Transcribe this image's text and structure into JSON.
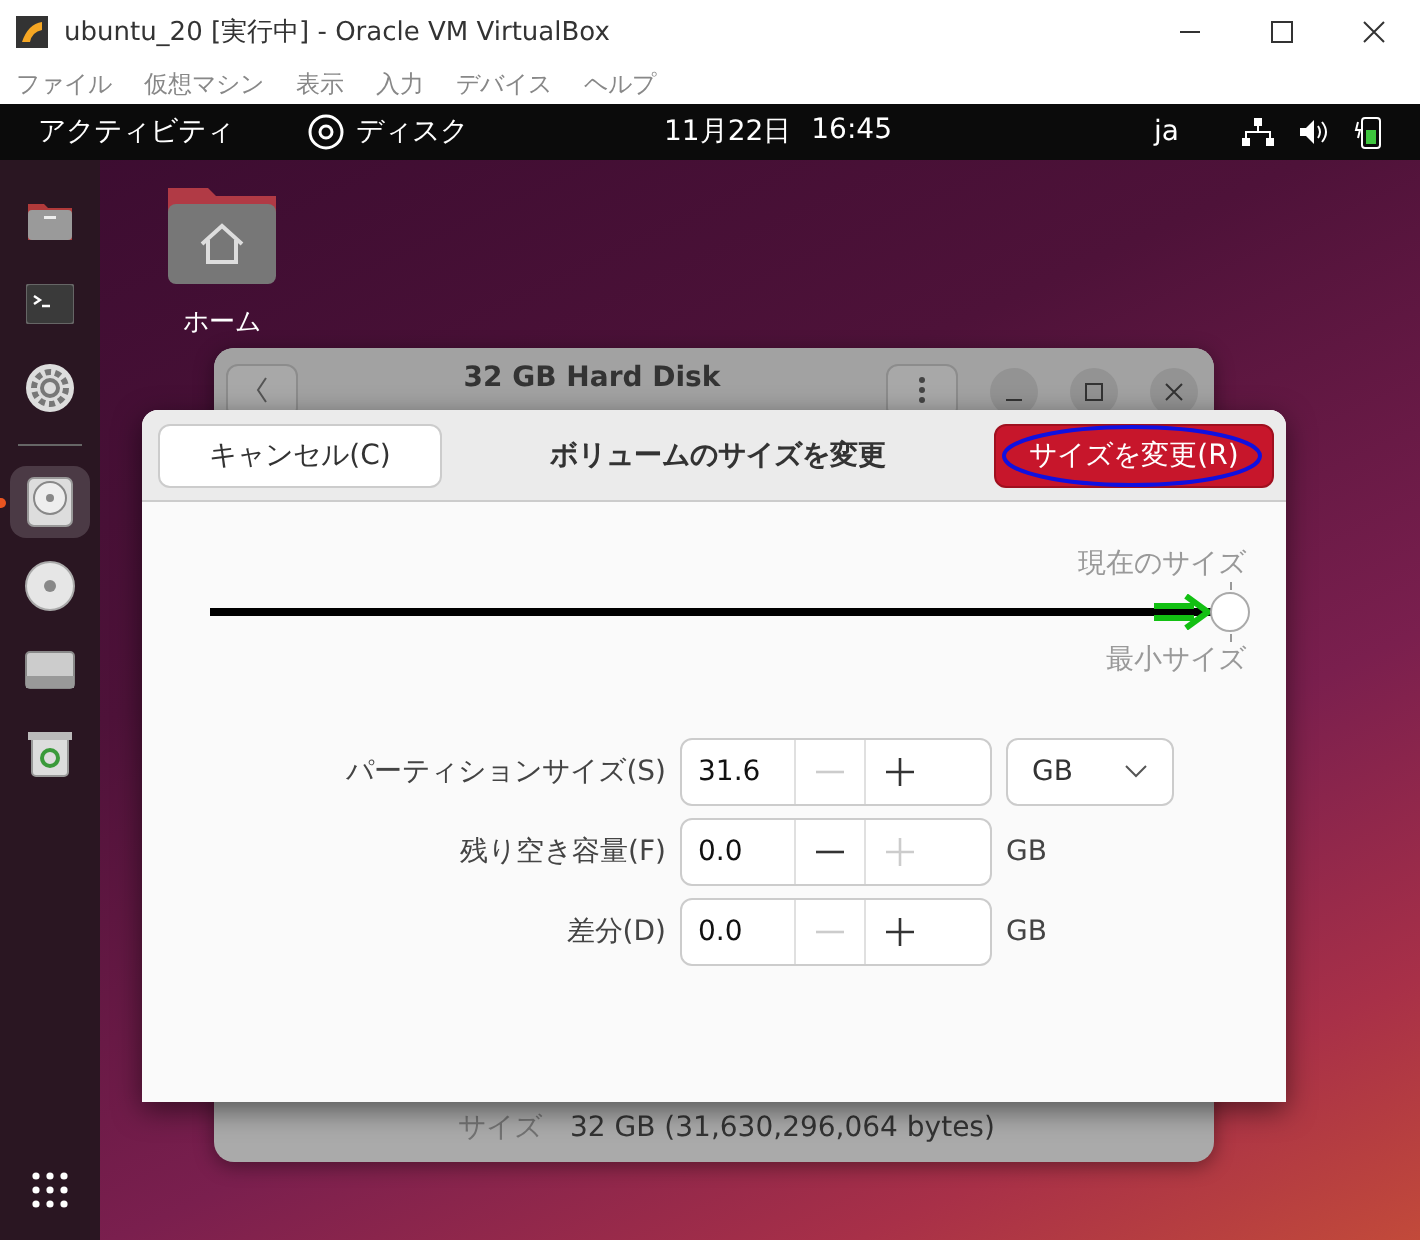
{
  "window": {
    "title": "ubuntu_20 [実行中] - Oracle VM VirtualBox"
  },
  "menu": [
    "ファイル",
    "仮想マシン",
    "表示",
    "入力",
    "デバイス",
    "ヘルプ"
  ],
  "top_bar": {
    "activities": "アクティビティ",
    "app": "ディスク",
    "date": "11月22日",
    "time": "16:45",
    "language": "ja"
  },
  "dock": {
    "favorites": [
      {
        "kind": "files",
        "selected": false
      },
      {
        "kind": "terminal",
        "selected": false
      },
      {
        "kind": "settings",
        "selected": false
      }
    ],
    "others": [
      {
        "kind": "disks",
        "selected": true
      },
      {
        "kind": "cd",
        "selected": false
      },
      {
        "kind": "drive",
        "selected": false
      },
      {
        "kind": "trash",
        "selected": false
      }
    ]
  },
  "desktop_icons": [
    {
      "label": "ホーム"
    }
  ],
  "disk_window": {
    "title": "32 GB Hard Disk",
    "size_label": "サイズ",
    "size_value": "32 GB (31,630,296,064 bytes)"
  },
  "dialog": {
    "title": "ボリュームのサイズを変更",
    "cancel": "キャンセル(C)",
    "confirm": "サイズを変更(R)",
    "slider": {
      "level": 1,
      "current_label": "現在のサイズ",
      "minimum_label": "最小サイズ"
    },
    "rows": [
      {
        "kind": "dropdown",
        "label": "パーティションサイズ(S)",
        "value": "31.6",
        "minus_disabled": true,
        "plus_disabled": false,
        "unit": "GB"
      },
      {
        "kind": "text",
        "label": "残り空き容量(F)",
        "value": "0.0",
        "minus_disabled": false,
        "plus_disabled": true,
        "unit": "GB"
      },
      {
        "kind": "text",
        "label": "差分(D)",
        "value": "0.0",
        "minus_disabled": true,
        "plus_disabled": false,
        "unit": "GB"
      }
    ]
  }
}
